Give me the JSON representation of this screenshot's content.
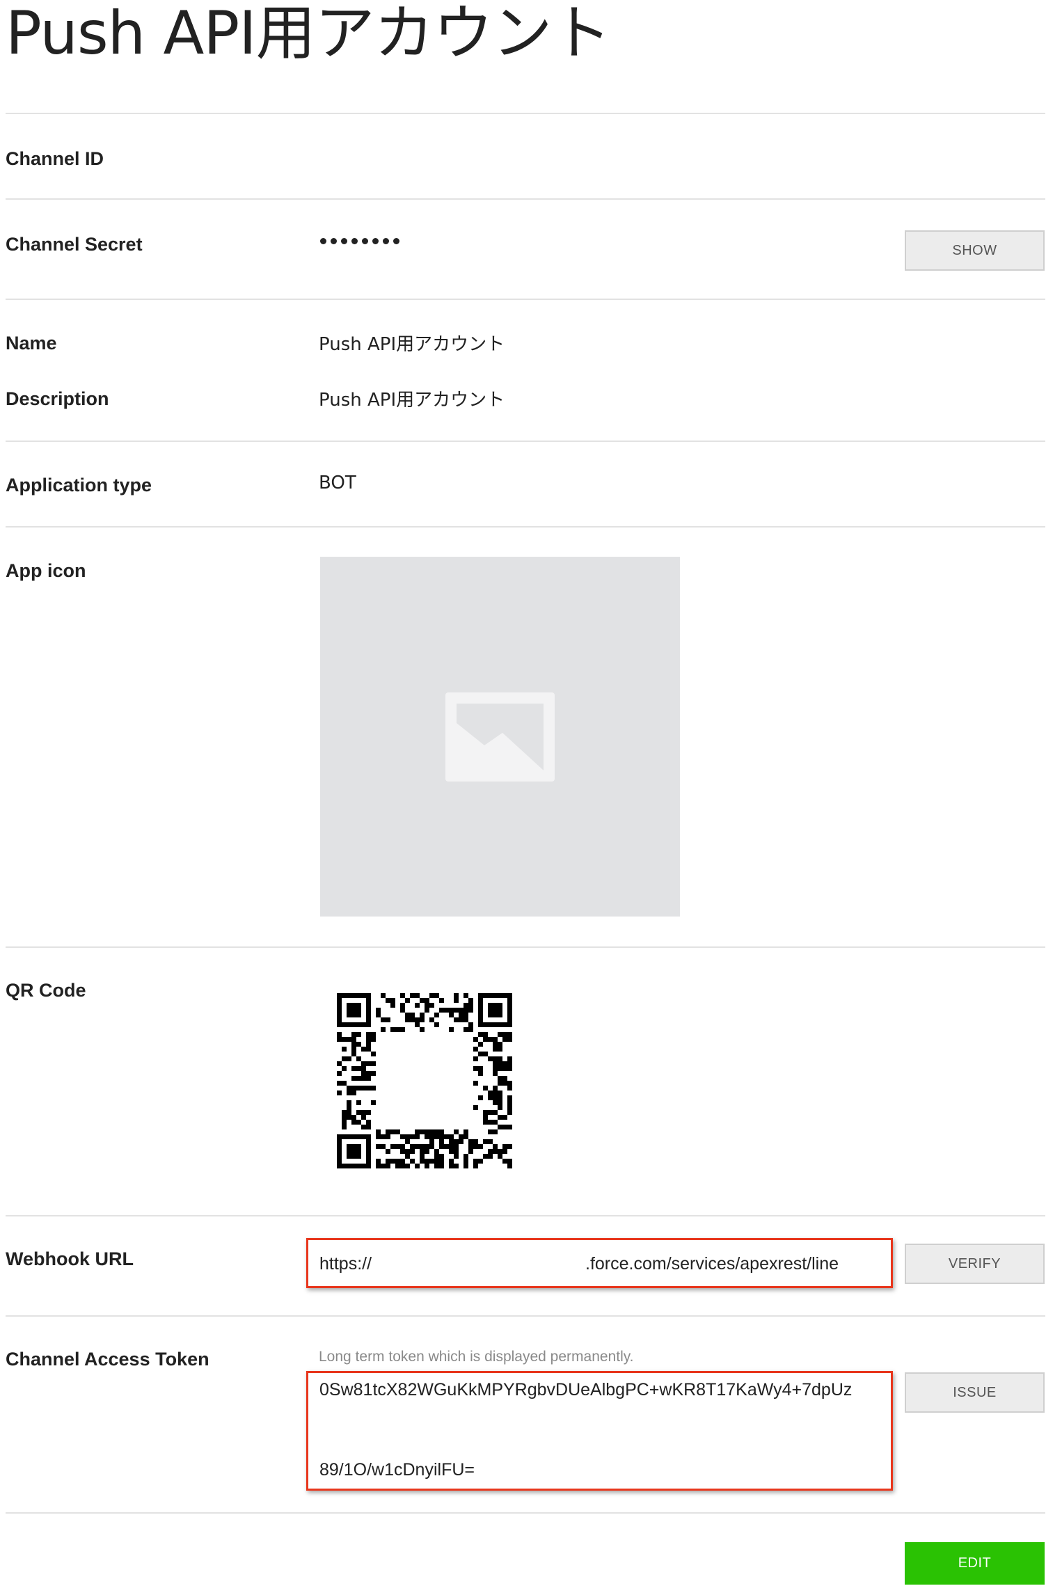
{
  "page": {
    "title": "Push API用アカウント"
  },
  "rows": {
    "channel_id": {
      "label": "Channel ID"
    },
    "channel_secret": {
      "label": "Channel Secret",
      "value": "••••••••",
      "button": "SHOW"
    },
    "name": {
      "label": "Name",
      "value": "Push API用アカウント"
    },
    "description": {
      "label": "Description",
      "value": "Push API用アカウント"
    },
    "application_type": {
      "label": "Application type",
      "value": "BOT"
    },
    "app_icon": {
      "label": "App icon",
      "icon": "image-placeholder-icon"
    },
    "qr_code": {
      "label": "QR Code"
    },
    "webhook_url": {
      "label": "Webhook URL",
      "prefix": "https://",
      "suffix": ".force.com/services/apexrest/line",
      "button": "VERIFY"
    },
    "channel_access_token": {
      "label": "Channel Access Token",
      "hint": "Long term token which is displayed permanently.",
      "line1": "0Sw81tcX82WGuKkMPYRgbvDUeAlbgPC+wKR8T17KaWy4+7dpUz",
      "line2": "89/1O/w1cDnyilFU=",
      "button": "ISSUE"
    }
  },
  "footer": {
    "edit_button": "EDIT"
  },
  "colors": {
    "accent_green": "#2ac203",
    "highlight_red": "#e8361c",
    "divider": "#e2e2e2"
  }
}
